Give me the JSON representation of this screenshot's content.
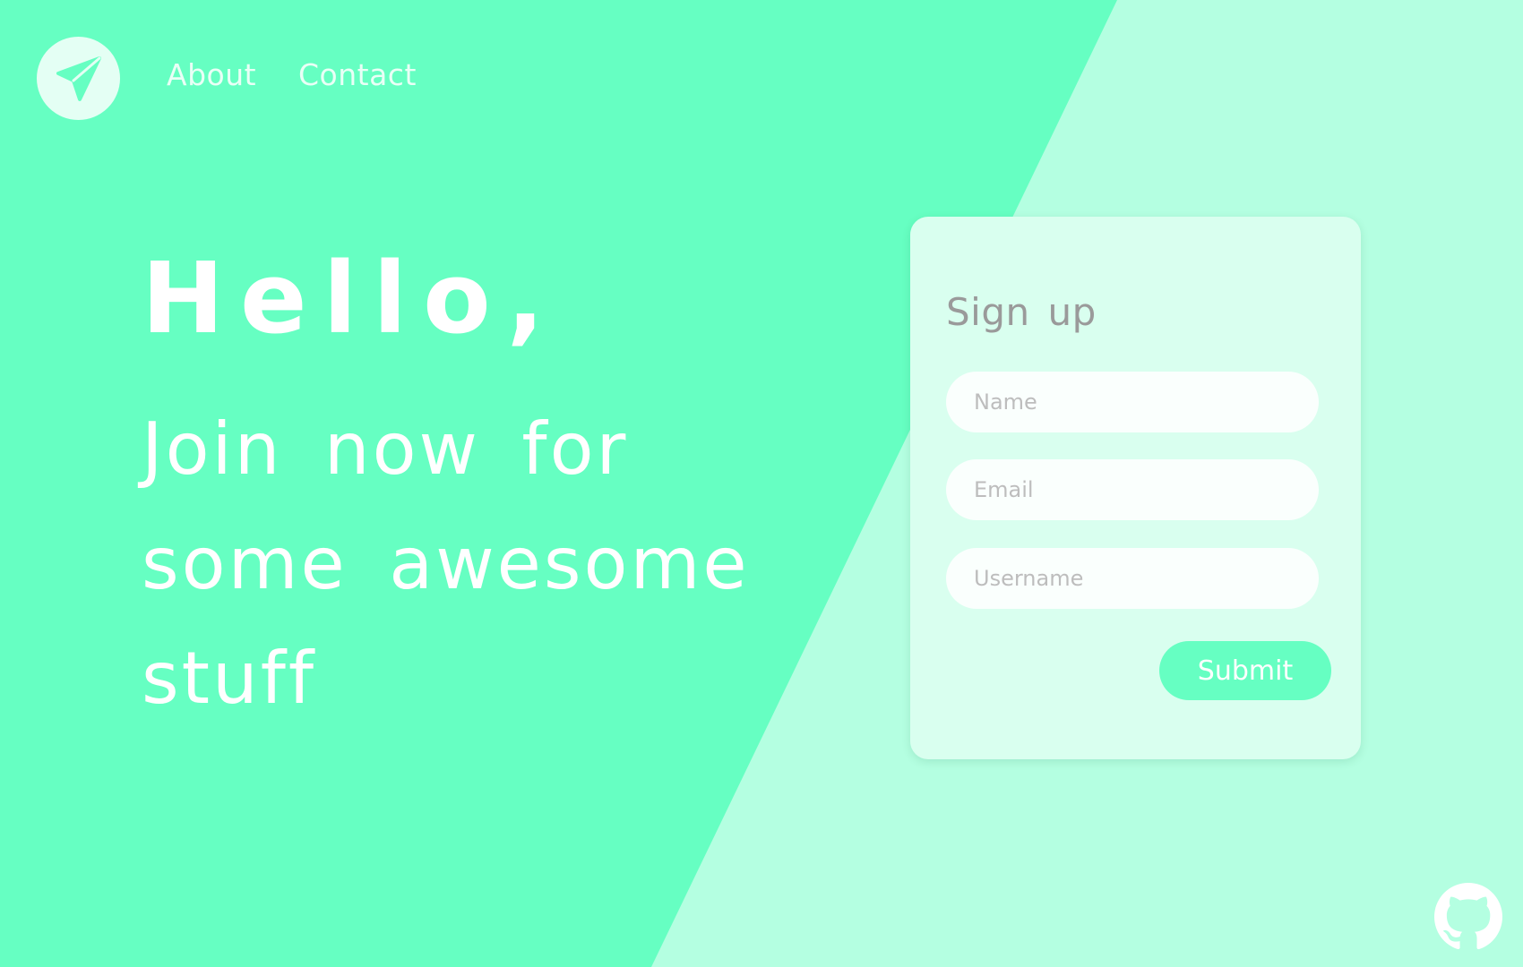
{
  "nav": {
    "links": [
      {
        "label": "About"
      },
      {
        "label": "Contact"
      }
    ]
  },
  "hero": {
    "greeting": "Hello,",
    "tagline": "Join now for some awesome stuff"
  },
  "signup": {
    "title": "Sign up",
    "fields": [
      {
        "placeholder": "Name"
      },
      {
        "placeholder": "Email"
      },
      {
        "placeholder": "Username"
      }
    ],
    "submit_label": "Submit"
  },
  "icons": {
    "logo": "paper-plane-icon",
    "github": "github-icon"
  },
  "colors": {
    "primary": "#66ffc2",
    "secondary": "#b4ffe1",
    "card": "#d9ffef"
  }
}
